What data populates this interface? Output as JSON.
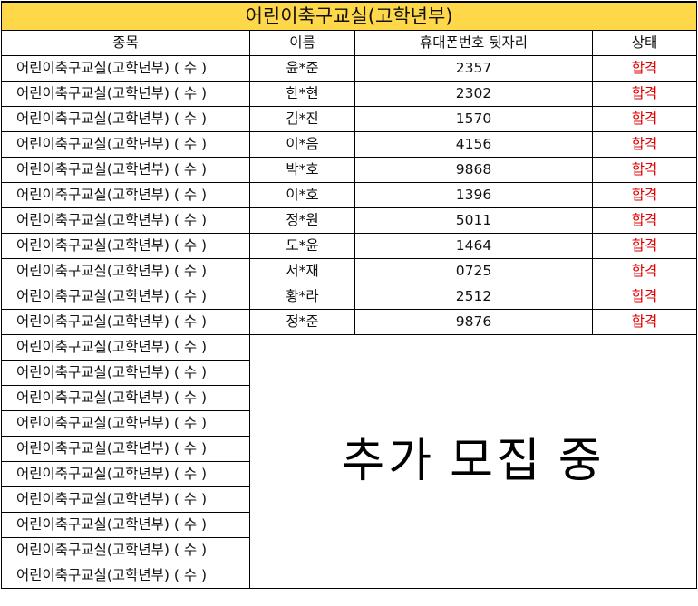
{
  "title": "어린이축구교실(고학년부)",
  "headers": {
    "event": "종목",
    "name": "이름",
    "phone": "휴대폰번호 뒷자리",
    "status": "상태"
  },
  "rows": [
    {
      "event": "어린이축구교실(고학년부) ( 수 )",
      "name": "윤*준",
      "phone": "2357",
      "status": "합격"
    },
    {
      "event": "어린이축구교실(고학년부) ( 수 )",
      "name": "한*현",
      "phone": "2302",
      "status": "합격"
    },
    {
      "event": "어린이축구교실(고학년부) ( 수 )",
      "name": "김*진",
      "phone": "1570",
      "status": "합격"
    },
    {
      "event": "어린이축구교실(고학년부) ( 수 )",
      "name": "이*음",
      "phone": "4156",
      "status": "합격"
    },
    {
      "event": "어린이축구교실(고학년부) ( 수 )",
      "name": "박*호",
      "phone": "9868",
      "status": "합격"
    },
    {
      "event": "어린이축구교실(고학년부) ( 수 )",
      "name": "이*호",
      "phone": "1396",
      "status": "합격"
    },
    {
      "event": "어린이축구교실(고학년부) ( 수 )",
      "name": "정*원",
      "phone": "5011",
      "status": "합격"
    },
    {
      "event": "어린이축구교실(고학년부) ( 수 )",
      "name": "도*윤",
      "phone": "1464",
      "status": "합격"
    },
    {
      "event": "어린이축구교실(고학년부) ( 수 )",
      "name": "서*재",
      "phone": "0725",
      "status": "합격"
    },
    {
      "event": "어린이축구교실(고학년부) ( 수 )",
      "name": "황*라",
      "phone": "2512",
      "status": "합격"
    },
    {
      "event": "어린이축구교실(고학년부) ( 수 )",
      "name": "정*준",
      "phone": "9876",
      "status": "합격"
    }
  ],
  "open_rows": [
    "어린이축구교실(고학년부) ( 수 )",
    "어린이축구교실(고학년부) ( 수 )",
    "어린이축구교실(고학년부) ( 수 )",
    "어린이축구교실(고학년부) ( 수 )",
    "어린이축구교실(고학년부) ( 수 )",
    "어린이축구교실(고학년부) ( 수 )",
    "어린이축구교실(고학년부) ( 수 )",
    "어린이축구교실(고학년부) ( 수 )",
    "어린이축구교실(고학년부) ( 수 )",
    "어린이축구교실(고학년부) ( 수 )"
  ],
  "recruit_words": [
    "추가",
    "모집",
    "중"
  ],
  "colors": {
    "title_bg": "#ffd84a",
    "status_text": "#e00000"
  }
}
